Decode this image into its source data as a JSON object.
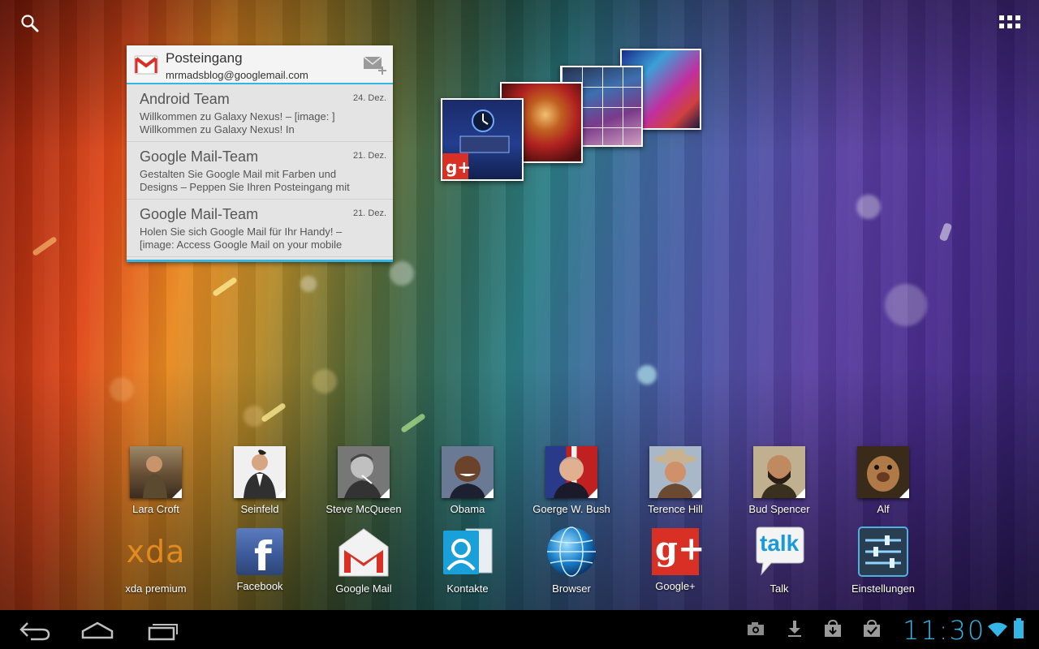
{
  "gmail_widget": {
    "title": "Posteingang",
    "account": "mrmadsblog@googlemail.com",
    "messages": [
      {
        "sender": "Android Team",
        "date": "24. Dez.",
        "snippet_line1": "Willkommen zu Galaxy Nexus! – [image: ]",
        "snippet_line2": "Willkommen zu Galaxy Nexus! In"
      },
      {
        "sender": "Google Mail-Team",
        "date": "21. Dez.",
        "snippet_line1": "Gestalten Sie Google Mail mit Farben und",
        "snippet_line2": "Designs – Peppen Sie Ihren Posteingang mit"
      },
      {
        "sender": "Google Mail-Team",
        "date": "21. Dez.",
        "snippet_line1": "Holen Sie sich Google Mail für Ihr Handy! –",
        "snippet_line2": "[image: Access Google Mail on your mobile"
      }
    ]
  },
  "contacts": [
    {
      "label": "Lara Croft"
    },
    {
      "label": "Seinfeld"
    },
    {
      "label": "Steve McQueen"
    },
    {
      "label": "Obama"
    },
    {
      "label": "Goerge W. Bush"
    },
    {
      "label": "Terence Hill"
    },
    {
      "label": "Bud Spencer"
    },
    {
      "label": "Alf"
    }
  ],
  "apps": [
    {
      "label": "xda premium",
      "icon_text": "xda"
    },
    {
      "label": "Facebook",
      "icon_text": "f"
    },
    {
      "label": "Google Mail",
      "icon_text": "M"
    },
    {
      "label": "Kontakte",
      "icon_text": ""
    },
    {
      "label": "Browser",
      "icon_text": ""
    },
    {
      "label": "Google+",
      "icon_text": "g+"
    },
    {
      "label": "Talk",
      "icon_text": "talk"
    },
    {
      "label": "Einstellungen",
      "icon_text": ""
    }
  ],
  "statusbar": {
    "time": "11:30"
  },
  "colors": {
    "accent": "#33b5e5",
    "navbar": "#000000"
  },
  "icons": [
    "search-icon",
    "all-apps-icon",
    "back-icon",
    "home-icon",
    "recent-apps-icon",
    "camera-icon",
    "download-icon",
    "market-icon",
    "task-icon",
    "wifi-icon",
    "battery-icon"
  ]
}
